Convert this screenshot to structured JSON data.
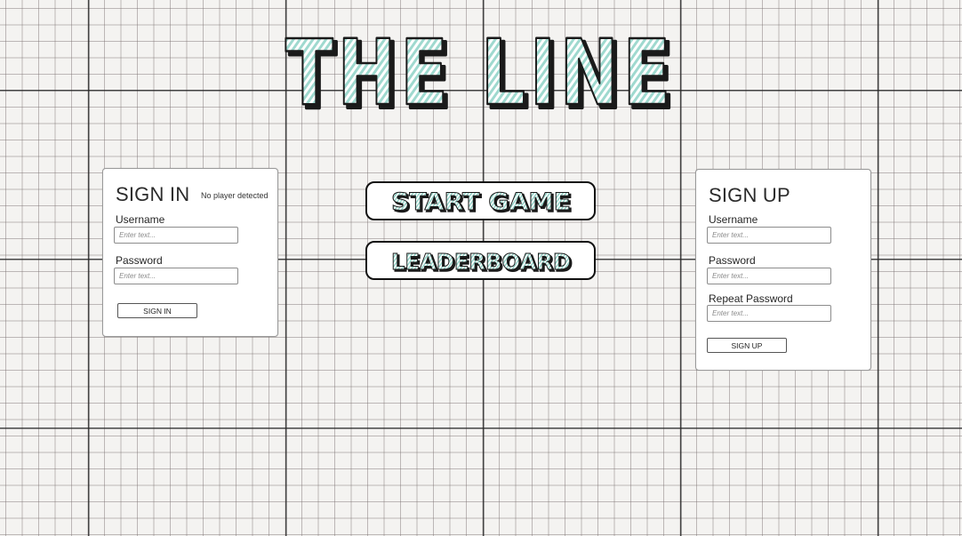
{
  "title": "THE LINE",
  "menu": {
    "start_label": "START GAME",
    "leaderboard_label": "LEADERBOARD"
  },
  "signin": {
    "heading": "SIGN IN",
    "status": "No player detected",
    "username_label": "Username",
    "username_placeholder": "Enter text...",
    "password_label": "Password",
    "password_placeholder": "Enter text...",
    "button_label": "SIGN IN"
  },
  "signup": {
    "heading": "SIGN UP",
    "username_label": "Username",
    "username_placeholder": "Enter text...",
    "password_label": "Password",
    "password_placeholder": "Enter text...",
    "repeat_label": "Repeat Password",
    "repeat_placeholder": "Enter text...",
    "button_label": "SIGN UP"
  },
  "colors": {
    "title_fill": "#a8e0d6",
    "title_stroke": "#1a1a1a",
    "button_text_fill": "#a9ddd3"
  }
}
